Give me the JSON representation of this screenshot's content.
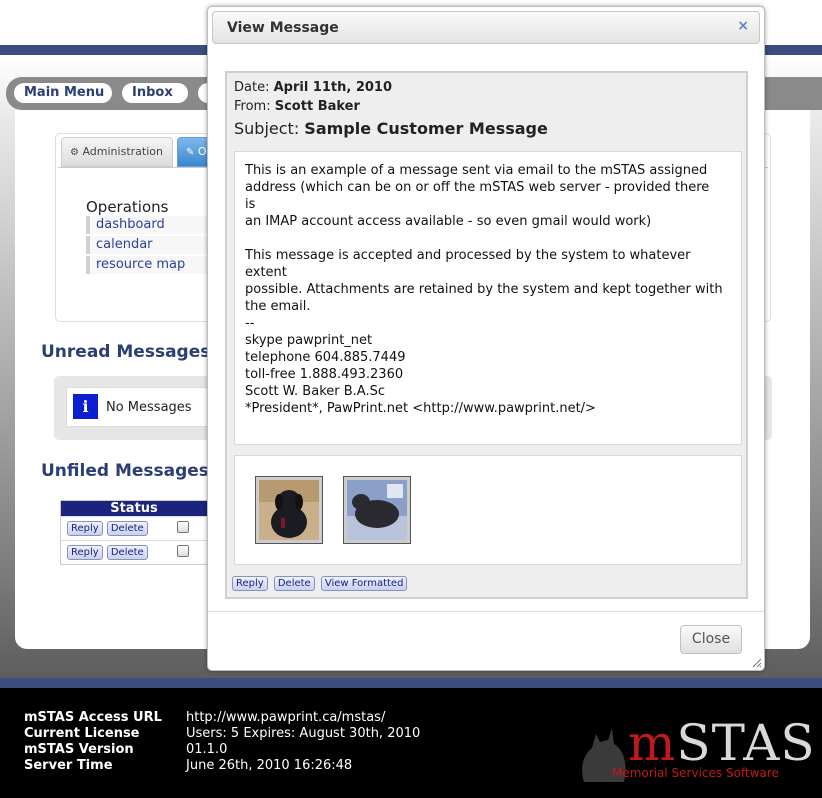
{
  "nav": {
    "main_menu": "Main Menu",
    "inbox": "Inbox",
    "partial": "I"
  },
  "tabs": {
    "administration": "Administration",
    "operations_partial": "O"
  },
  "operations": {
    "title": "Operations",
    "links": [
      "dashboard",
      "calendar",
      "resource map"
    ]
  },
  "unread": {
    "title": "Unread Messages",
    "empty_text": "No Messages",
    "icon": "info-icon"
  },
  "unfiled": {
    "title": "Unfiled Messages",
    "status_header": "Status",
    "rows": [
      {
        "reply": "Reply",
        "delete": "Delete"
      },
      {
        "reply": "Reply",
        "delete": "Delete"
      }
    ]
  },
  "footer": {
    "url_label": "mSTAS Access URL",
    "url_value": "http://www.pawprint.ca/mstas/",
    "license_label": "Current License",
    "license_value": "Users: 5 Expires: August 30th, 2010",
    "version_label": "mSTAS Version",
    "version_value": "01.1.0",
    "time_label": "Server Time",
    "time_value": "June 26th, 2010 16:26:48"
  },
  "logo": {
    "m": "m",
    "stas": "STAS",
    "subtitle": "Memorial Services Software"
  },
  "dialog": {
    "title": "View Message",
    "close_icon": "×",
    "date_label": "Date:",
    "date_value": "April 11th, 2010",
    "from_label": "From:",
    "from_value": "Scott Baker",
    "subject_label": "Subject:",
    "subject_value": "Sample Customer Message",
    "body": "This is an example of a message sent via email to the mSTAS assigned\naddress (which can be on or off the mSTAS web server - provided there\nis\nan IMAP account access available - so even gmail would work)\n\nThis message is accepted and processed by the system to whatever\nextent\npossible. Attachments are retained by the system and kept together with\nthe email.\n--\nskype pawprint_net\ntelephone 604.885.7449\ntoll-free 1.888.493.2360\nScott W. Baker B.A.Sc\n*President*, PawPrint.net <http://www.pawprint.net/>",
    "buttons": {
      "reply": "Reply",
      "delete": "Delete",
      "view_formatted": "View Formatted"
    },
    "close_button": "Close"
  },
  "colors": {
    "brand_blue": "#2b3f75",
    "logo_red": "#c21a1a",
    "header_navy": "#1a237e"
  }
}
